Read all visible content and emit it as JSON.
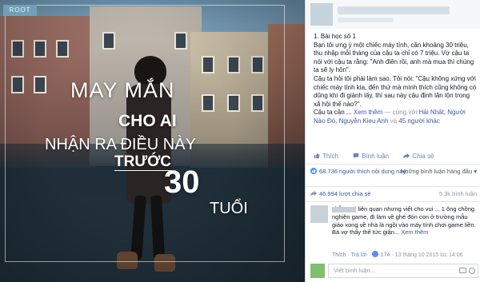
{
  "image": {
    "brand_tag": "ROOT",
    "quote": {
      "line1": "MAY MẮN",
      "line2": "CHO AI",
      "line3": "NHẬN RA ĐIỀU NÀY",
      "line4": "TRƯỚC",
      "line5": "30",
      "line6": "TUỔI"
    }
  },
  "post": {
    "body": {
      "title": "1. Bài học số 1",
      "para1": "Bạn tôi ưng ý một chiếc máy tính, cần khoảng 30 triệu, thu nhập mỗi tháng của cậu ta chỉ có 7 triệu. Vợ cậu ta nói với cậu ta rằng: \"Anh điên rồi, anh mà mua thì chúng ta sẽ ly hôn\".",
      "para2": "Cậu ta hỏi tôi phải làm sao. Tôi nói: \"Cậu không xứng với chiếc máy tính kia, đến thứ mà mình thích cũng không có dũng khí đi giành lấy, thì sau này cậu định lăn lộn trong xã hội thế nào?\".",
      "tail": "Cậu ta cần ...",
      "see_more": "Xem thêm",
      "with_label": "— cùng với",
      "tag1": "Hải Nhất,",
      "tag2": "Người Nào Đó,",
      "tag3": "Nguyễn Kieu Anh",
      "and_label": "và",
      "tag4": "45 người khác"
    },
    "actions": {
      "like": "Thích",
      "comment": "Bình luận",
      "share": "Chia sẻ"
    },
    "stats": {
      "likes": "68.736 người thích nội dung này.",
      "comment_filter": "Những bình luận hàng đầu ▾",
      "shares": "46.994 lượt chia sẻ",
      "comments_count": "5,3k bình luận"
    },
    "top_comment": {
      "text": "chẳng có liên quan nhưng viết cho vui ... 1 ông chồng nghiện game, đi làm về ghé đón con ở trường mẫu giáo xong về nhà là ngồi vào máy tính chơi game liền. Bà vợ thấy thế tức giận...",
      "see_more": "Xem thêm",
      "like": "Thích",
      "reply": "Trả lời",
      "reactions": "174",
      "timestamp": "13 tháng 10 2015 lúc 14:06"
    },
    "composer": {
      "placeholder": "Viết bình luận..."
    }
  },
  "colors": {
    "fb_link": "#3b5998",
    "fb_meta": "#9197a3",
    "text": "#141823"
  }
}
